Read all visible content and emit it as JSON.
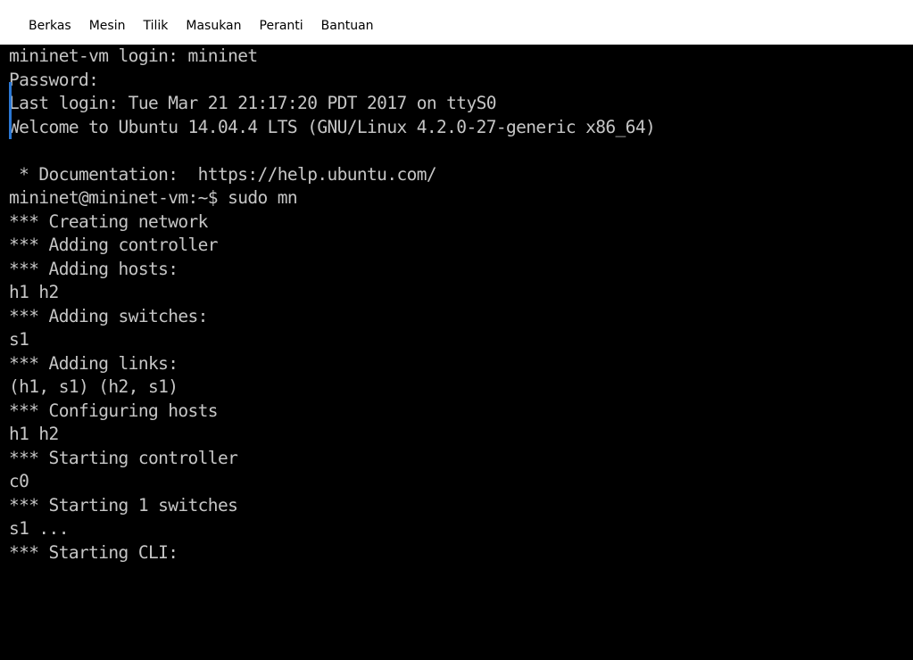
{
  "menubar": {
    "items": [
      {
        "label": "Berkas"
      },
      {
        "label": "Mesin"
      },
      {
        "label": "Tilik"
      },
      {
        "label": "Masukan"
      },
      {
        "label": "Peranti"
      },
      {
        "label": "Bantuan"
      }
    ]
  },
  "terminal": {
    "lines": [
      "mininet-vm login: mininet",
      "Password:",
      "Last login: Tue Mar 21 21:17:20 PDT 2017 on ttyS0",
      "Welcome to Ubuntu 14.04.4 LTS (GNU/Linux 4.2.0-27-generic x86_64)",
      "",
      " * Documentation:  https://help.ubuntu.com/",
      "mininet@mininet-vm:~$ sudo mn",
      "*** Creating network",
      "*** Adding controller",
      "*** Adding hosts:",
      "h1 h2",
      "*** Adding switches:",
      "s1",
      "*** Adding links:",
      "(h1, s1) (h2, s1)",
      "*** Configuring hosts",
      "h1 h2",
      "*** Starting controller",
      "c0",
      "*** Starting 1 switches",
      "s1 ...",
      "*** Starting CLI:"
    ]
  },
  "colors": {
    "terminal_bg": "#000000",
    "terminal_fg": "#c6c6c6",
    "menubar_bg": "#ffffff",
    "accent": "#2b78d4"
  }
}
